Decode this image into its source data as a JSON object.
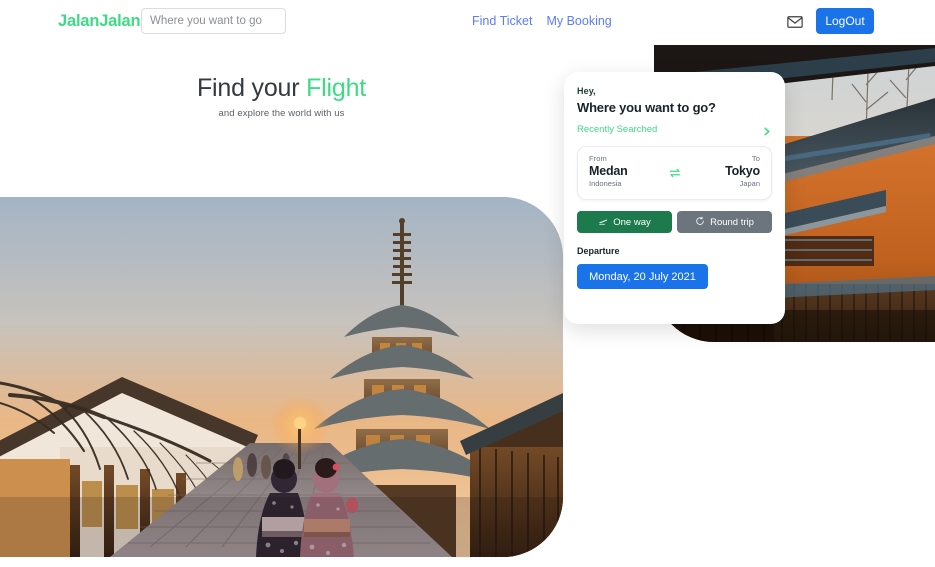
{
  "navbar": {
    "brand": "JalanJalan",
    "search_placeholder": "Where you want to go",
    "search_value": "",
    "links": [
      {
        "label": "Find Ticket"
      },
      {
        "label": "My Booking"
      }
    ],
    "mail_icon": "envelope-icon",
    "logout_label": "LogOut",
    "logout_color": "#1a73e8",
    "brand_color": "#3ddc84",
    "link_color": "#5c7cfa"
  },
  "hero": {
    "title_plain": "Find your ",
    "title_accent": "Flight",
    "subtitle": "and explore the world with us",
    "accent_color": "#3ddc84",
    "title_color": "#343a40"
  },
  "photos": {
    "left": {
      "alt": "Kyoto street at sunset with pagoda and two women in kimono"
    },
    "right": {
      "alt": "Traditional Japanese building with blue tiled roof"
    }
  },
  "card": {
    "greeting": "Hey,",
    "question": "Where you want to go?",
    "recently_searched": "Recently Searched",
    "recently_searched_icon": "chevron-right-icon",
    "route": {
      "from_label": "From",
      "from_city": "Medan",
      "from_country": "Indonesia",
      "swap_icon": "swap-arrows-icon",
      "to_label": "To",
      "to_city": "Tokyo",
      "to_country": "Japan"
    },
    "trip_types": [
      {
        "label": "One way",
        "icon": "plane-icon",
        "active": true,
        "color": "#1d7a4d"
      },
      {
        "label": "Round trip",
        "icon": "refresh-icon",
        "active": false,
        "color": "#6c757d"
      }
    ],
    "departure_label": "Departure",
    "departure_date": "Monday, 20 July 2021",
    "departure_color": "#1a73e8",
    "accent_color": "#3ddc84"
  }
}
